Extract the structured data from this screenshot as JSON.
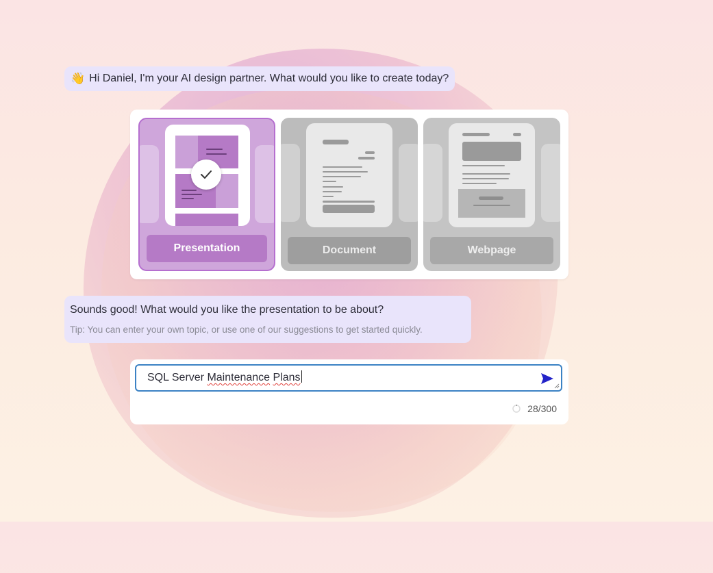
{
  "chat": {
    "greeting_emoji": "👋",
    "greeting": "Hi Daniel, I'm your AI design partner. What would you like to create today?",
    "question": "Sounds good! What would you like the presentation to be about?",
    "tip": "Tip: You can enter your own topic, or use one of our suggestions to get started quickly."
  },
  "types": {
    "presentation": "Presentation",
    "document": "Document",
    "webpage": "Webpage",
    "selected": "Presentation"
  },
  "input": {
    "word1": "SQL Server ",
    "word2": "Maintenance",
    "space": " ",
    "word3": "Plans",
    "counter": "28/300"
  },
  "colors": {
    "accent_purple": "#b57ac6",
    "input_border": "#3b82c4",
    "send_icon": "#2323c8",
    "bubble_bg": "#e9e4fb"
  }
}
